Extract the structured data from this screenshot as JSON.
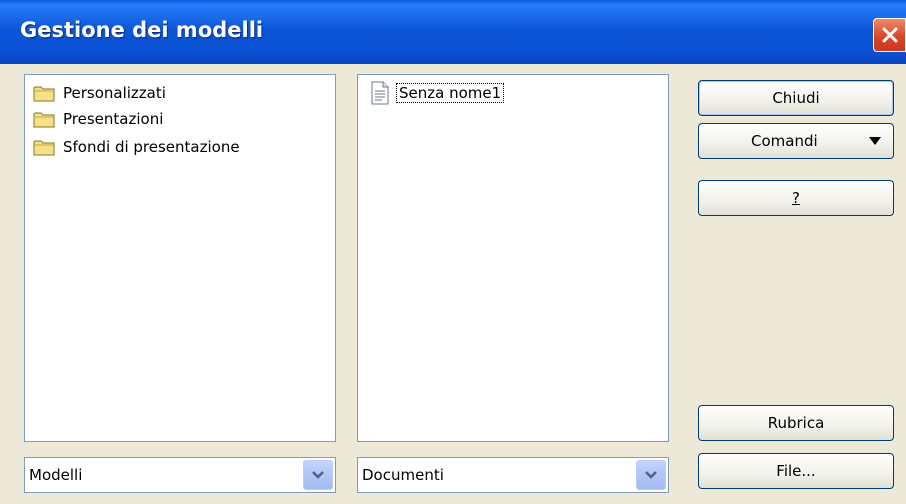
{
  "window": {
    "title": "Gestione dei modelli"
  },
  "templates_tree": {
    "items": [
      {
        "label": "Personalizzati",
        "icon": "folder-icon"
      },
      {
        "label": "Presentazioni",
        "icon": "folder-icon"
      },
      {
        "label": "Sfondi di presentazione",
        "icon": "folder-icon"
      }
    ]
  },
  "documents_list": {
    "items": [
      {
        "label": "Senza nome1",
        "icon": "document-icon"
      }
    ]
  },
  "buttons": {
    "close": "Chiudi",
    "commands": "Comandi",
    "help": "?",
    "address_book": "Rubrica",
    "file": "File..."
  },
  "selectors": {
    "left": {
      "value": "Modelli"
    },
    "right": {
      "value": "Documenti"
    }
  },
  "colors": {
    "titlebar": "#0a4ed0",
    "dialog_bg": "#ece9d8",
    "close_button": "#d9462b",
    "panel_border": "#7f9db9",
    "combo_button": "#b0c6f7"
  }
}
